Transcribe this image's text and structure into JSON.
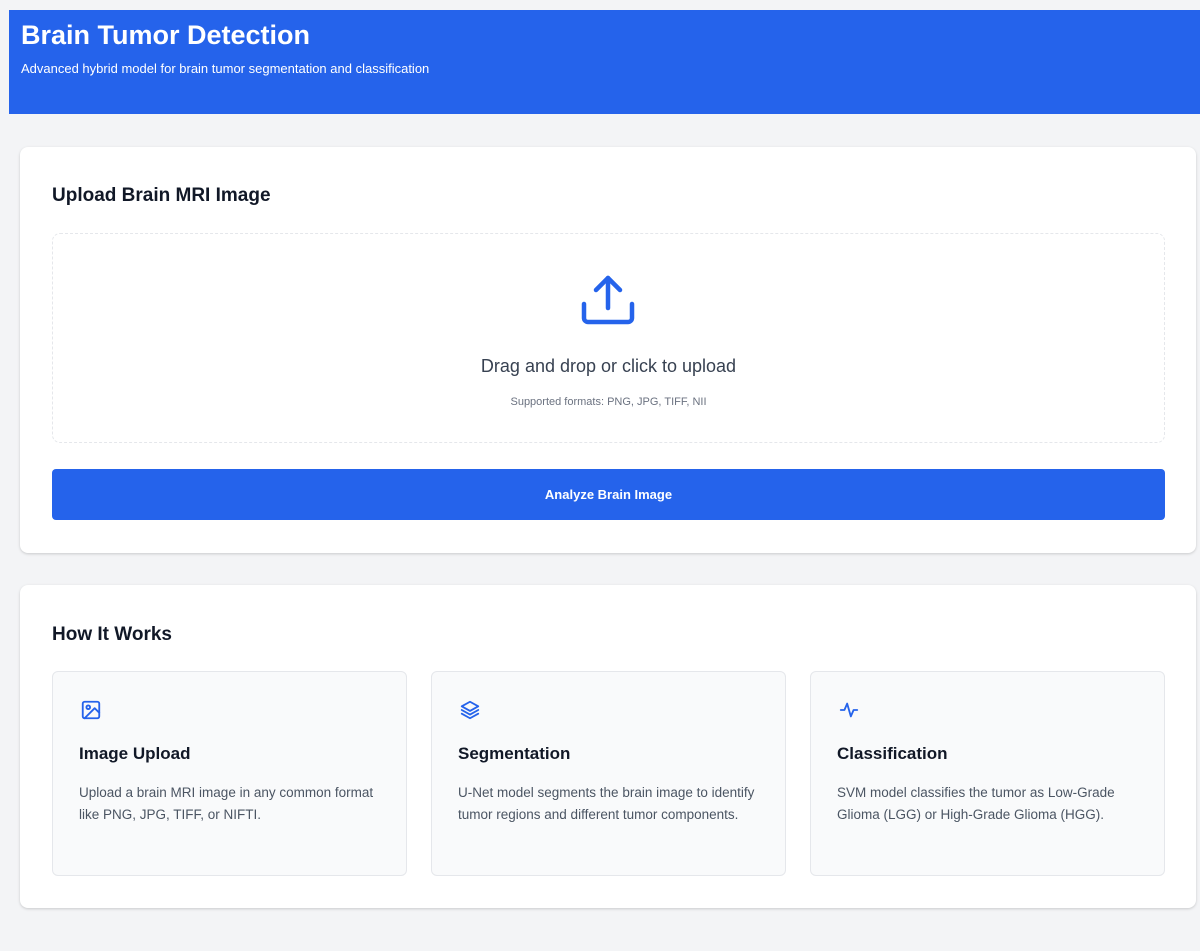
{
  "header": {
    "title": "Brain Tumor Detection",
    "subtitle": "Advanced hybrid model for brain tumor segmentation and classification"
  },
  "upload": {
    "title": "Upload Brain MRI Image",
    "icon": "upload-icon",
    "drop_text": "Drag and drop or click to upload",
    "formats_text": "Supported formats: PNG, JPG, TIFF, NII",
    "analyze_label": "Analyze Brain Image"
  },
  "how": {
    "title": "How It Works",
    "steps": [
      {
        "icon": "image-icon",
        "title": "Image Upload",
        "description": "Upload a brain MRI image in any common format like PNG, JPG, TIFF, or NIFTI."
      },
      {
        "icon": "layers-icon",
        "title": "Segmentation",
        "description": "U-Net model segments the brain image to identify tumor regions and different tumor components."
      },
      {
        "icon": "activity-icon",
        "title": "Classification",
        "description": "SVM model classifies the tumor as Low-Grade Glioma (LGG) or High-Grade Glioma (HGG)."
      }
    ]
  },
  "colors": {
    "accent": "#2563eb",
    "background": "#f3f4f6",
    "card": "#ffffff",
    "step_card": "#f9fafb"
  }
}
